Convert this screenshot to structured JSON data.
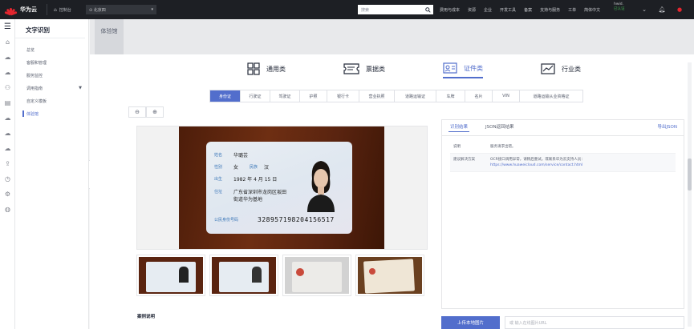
{
  "topbar": {
    "logo_text": "华为云",
    "logo_sub": "HUAWEI",
    "console_label": "控制台",
    "region": "北京四",
    "search_placeholder": "搜索",
    "nav": [
      "费用与成本",
      "资源",
      "企业",
      "开发工具",
      "备案",
      "支持与服务",
      "工单",
      "简体中文"
    ],
    "user_name": "hwid.",
    "user_status": "已认证"
  },
  "rail_icons": [
    "menu-icon",
    "home-icon",
    "cloud-icon",
    "cloud-icon",
    "users-icon",
    "document-icon",
    "cloud-icon",
    "cloud-icon",
    "cloud-icon",
    "upload-icon",
    "clock-icon",
    "settings-icon",
    "globe-icon"
  ],
  "sidebar": {
    "title": "文字识别",
    "items": [
      {
        "label": "总览",
        "active": false
      },
      {
        "label": "客服和管理",
        "active": false
      },
      {
        "label": "服务监控",
        "active": false
      },
      {
        "label": "调用指南",
        "active": false,
        "expandable": true
      },
      {
        "label": "自定义模板",
        "active": false
      },
      {
        "label": "体验馆",
        "active": true
      }
    ]
  },
  "page_tab": "体验馆",
  "categories": [
    {
      "label": "通用类",
      "icon": "grid-icon",
      "active": false
    },
    {
      "label": "票据类",
      "icon": "ticket-icon",
      "active": false
    },
    {
      "label": "证件类",
      "icon": "id-card-icon",
      "active": true
    },
    {
      "label": "行业类",
      "icon": "chart-icon",
      "active": false
    }
  ],
  "subtabs": [
    {
      "label": "身份证",
      "active": true
    },
    {
      "label": "行驶证",
      "active": false
    },
    {
      "label": "驾驶证",
      "active": false
    },
    {
      "label": "护照",
      "active": false
    },
    {
      "label": "银行卡",
      "active": false
    },
    {
      "label": "营业执照",
      "active": false
    },
    {
      "label": "道路运输证",
      "active": false
    },
    {
      "label": "车牌",
      "active": false
    },
    {
      "label": "名片",
      "active": false
    },
    {
      "label": "VIN",
      "active": false
    },
    {
      "label": "道路运输从业资格证",
      "active": false
    }
  ],
  "idcard": {
    "name_field": "姓名",
    "name": "华璐芸",
    "gender_field": "性别",
    "gender": "女",
    "ethnicity_field": "民族",
    "ethnicity": "汉",
    "birth_field": "出生",
    "birth": "1982 年 4 月 15 日",
    "address_field": "住址",
    "address_line1": "广东省深圳市龙岗区坂田",
    "address_line2": "街道华为基地",
    "number_field": "公民身份号码",
    "number": "328957198204156517"
  },
  "case_title": "案例说明",
  "result": {
    "tab_result": "识别结果",
    "tab_json": "JSON返回结果",
    "export_label": "导出JSON",
    "rows": [
      {
        "key": "说明",
        "value": "服务请求出错。",
        "link": ""
      },
      {
        "key": "建议解决方案",
        "value": "OCR接口调用异常，请稍后重试。或联系华为云支持人员：",
        "link": "https://www.huaweicloud.com/service/contact.html"
      }
    ]
  },
  "upload_label": "上传本地图片",
  "url_placeholder": "或 输入在线图片URL",
  "colors": {
    "accent": "#526ecc",
    "topbar": "#1d1f24",
    "brand": "#e3262f"
  }
}
